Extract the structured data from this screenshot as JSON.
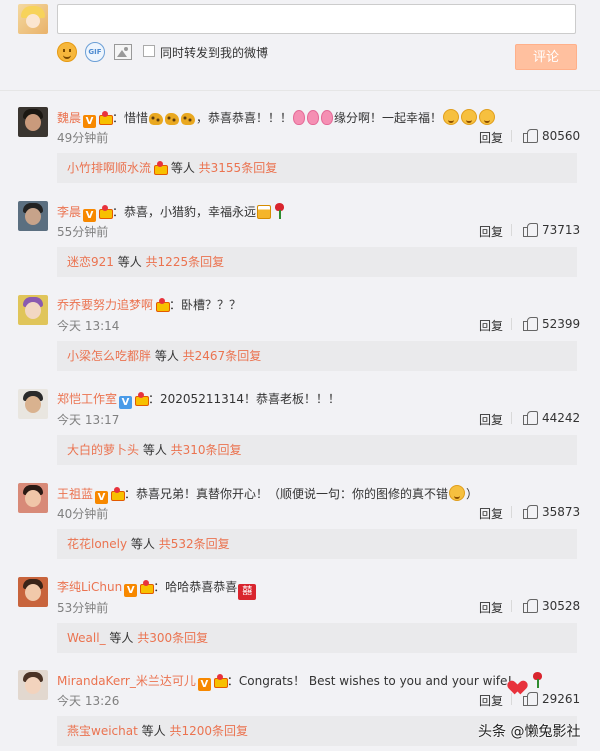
{
  "compose": {
    "input_value": "",
    "repost_label": "同时转发到我的微博",
    "submit_label": "评论",
    "gif_label": "GIF"
  },
  "comments": [
    {
      "username": "魏晨",
      "verified": "V",
      "text_a": "：惜惜",
      "text_b": "，恭喜恭喜！！！",
      "text_c": "缘分啊！一起幸福！",
      "time": "49分钟前",
      "reply": "回复",
      "likes": "80560",
      "sub_user": "小竹排啊顺水流",
      "sub_mid": " 等人 ",
      "sub_count": "共3155条回复"
    },
    {
      "username": "李晨",
      "verified": "V",
      "text_a": "：恭喜，小猎豹，幸福永远",
      "time": "55分钟前",
      "reply": "回复",
      "likes": "73713",
      "sub_user": "迷恋921",
      "sub_mid": " 等人 ",
      "sub_count": "共1225条回复"
    },
    {
      "username": "乔乔要努力追梦啊",
      "text_a": "：卧槽？？？",
      "time": "今天 13:14",
      "reply": "回复",
      "likes": "52399",
      "sub_user": "小梁怎么吃都胖",
      "sub_mid": " 等人 ",
      "sub_count": "共2467条回复"
    },
    {
      "username": "郑恺工作室",
      "verified": "V",
      "text_a": "：20205211314！恭喜老板！！！",
      "time": "今天 13:17",
      "reply": "回复",
      "likes": "44242",
      "sub_user": "大白的萝卜头",
      "sub_mid": " 等人 ",
      "sub_count": "共310条回复"
    },
    {
      "username": "王祖蓝",
      "verified": "V",
      "text_a": "：恭喜兄弟！真替你开心！（顺便说一句：你的图修的真不错",
      "text_b": "）",
      "time": "40分钟前",
      "reply": "回复",
      "likes": "35873",
      "sub_user": "花花lonely",
      "sub_mid": " 等人 ",
      "sub_count": "共532条回复"
    },
    {
      "username": "李纯LiChun",
      "verified": "V",
      "text_a": "：哈哈恭喜恭喜",
      "time": "53分钟前",
      "reply": "回复",
      "likes": "30528",
      "sub_user": "Weall_",
      "sub_mid": " 等人 ",
      "sub_count": "共300条回复"
    },
    {
      "username": "MirandaKerr_米兰达可儿",
      "verified": "V",
      "text_a": "：Congrats！ Best wishes to you and your wife!",
      "time": "今天 13:26",
      "reply": "回复",
      "likes": "29261",
      "sub_user": "燕宝weichat",
      "sub_mid": " 等人 ",
      "sub_count": "共1200条回复"
    }
  ],
  "watermark": "头条 @懒兔影社",
  "colors": {
    "username": "#eb7350",
    "submit_bg": "#ffc09f",
    "verified_orange": "#f78800",
    "verified_blue": "#4a9be8"
  }
}
